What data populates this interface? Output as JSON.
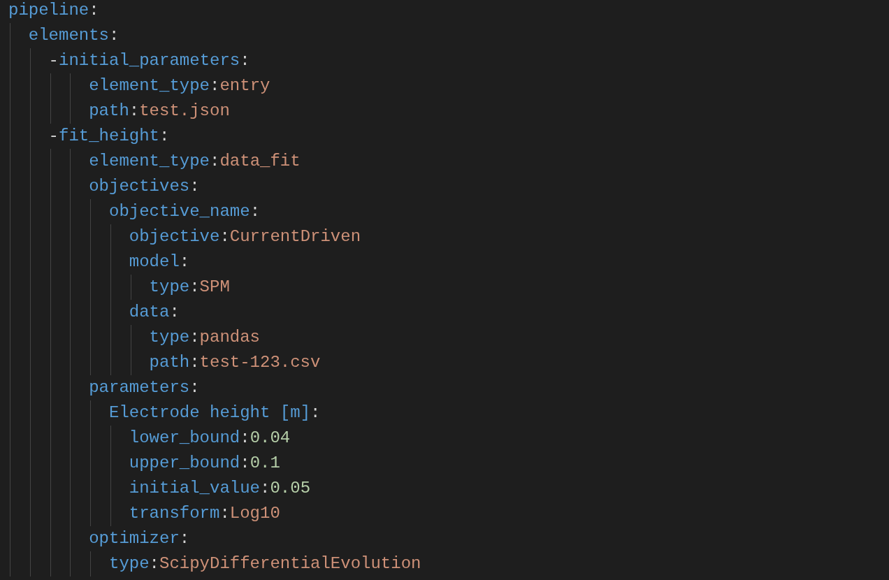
{
  "editor": {
    "nodes": [
      {
        "key": "pipeline",
        "separator": ":",
        "children": [
          {
            "key": "elements",
            "separator": ":",
            "children": [
              {
                "marker": "-",
                "key": "initial_parameters",
                "separator": ":",
                "children": [
                  {
                    "key": "element_type",
                    "separator": ":",
                    "value": "entry",
                    "kind": "string"
                  },
                  {
                    "key": "path",
                    "separator": ":",
                    "value": "test.json",
                    "kind": "string"
                  }
                ]
              },
              {
                "marker": "-",
                "key": "fit_height",
                "separator": ":",
                "children": [
                  {
                    "key": "element_type",
                    "separator": ":",
                    "value": "data_fit",
                    "kind": "string"
                  },
                  {
                    "key": "objectives",
                    "separator": ":",
                    "children": [
                      {
                        "key": "objective_name",
                        "separator": ":",
                        "children": [
                          {
                            "key": "objective",
                            "separator": ":",
                            "value": "CurrentDriven",
                            "kind": "string"
                          },
                          {
                            "key": "model",
                            "separator": ":",
                            "children": [
                              {
                                "key": "type",
                                "separator": ":",
                                "value": "SPM",
                                "kind": "string"
                              }
                            ]
                          },
                          {
                            "key": "data",
                            "separator": ":",
                            "children": [
                              {
                                "key": "type",
                                "separator": ":",
                                "value": "pandas",
                                "kind": "string"
                              },
                              {
                                "key": "path",
                                "separator": ":",
                                "value": "test-123.csv",
                                "kind": "string"
                              }
                            ]
                          }
                        ]
                      }
                    ]
                  },
                  {
                    "key": "parameters",
                    "separator": ":",
                    "children": [
                      {
                        "key": "Electrode height [m]",
                        "separator": ":",
                        "children": [
                          {
                            "key": "lower_bound",
                            "separator": ":",
                            "value": "0.04",
                            "kind": "number"
                          },
                          {
                            "key": "upper_bound",
                            "separator": ":",
                            "value": "0.1",
                            "kind": "number"
                          },
                          {
                            "key": "initial_value",
                            "separator": ":",
                            "value": "0.05",
                            "kind": "number"
                          },
                          {
                            "key": "transform",
                            "separator": ":",
                            "value": "Log10",
                            "kind": "string"
                          }
                        ]
                      }
                    ]
                  },
                  {
                    "key": "optimizer",
                    "separator": ":",
                    "children": [
                      {
                        "key": "type",
                        "separator": ":",
                        "value": "ScipyDifferentialEvolution",
                        "kind": "string"
                      }
                    ]
                  }
                ]
              }
            ]
          }
        ]
      }
    ]
  }
}
